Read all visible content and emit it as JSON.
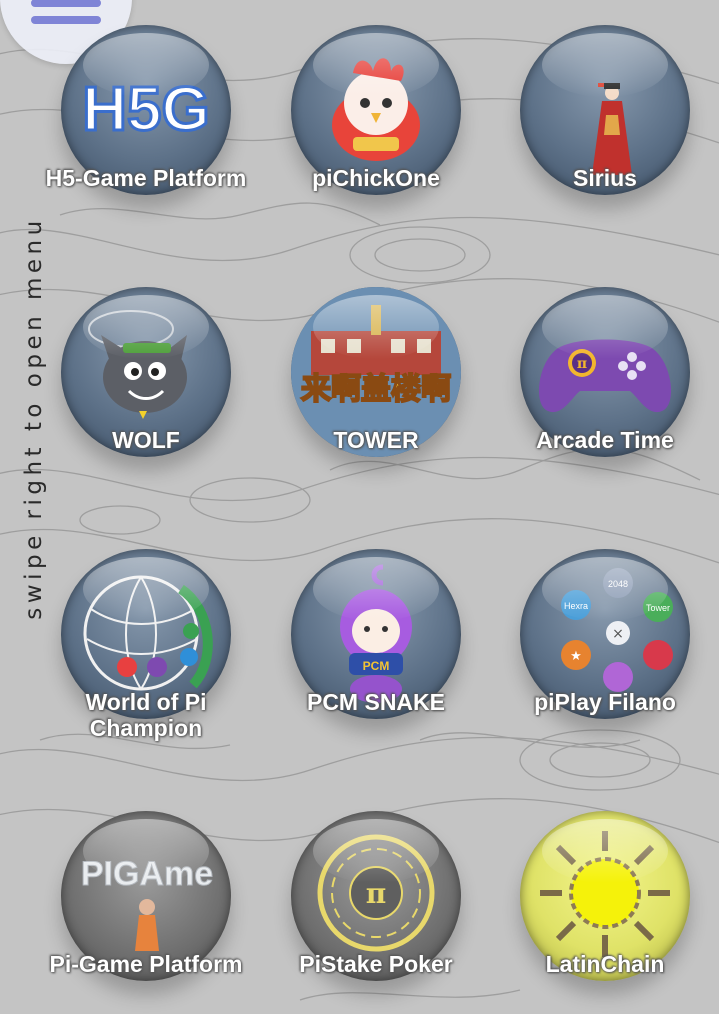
{
  "menu": {
    "icon": "hamburger-icon",
    "accent_color": "#7f84d6"
  },
  "swipe_hint": "swipe right to open menu",
  "games": [
    {
      "label": "H5-Game Platform",
      "icon": "h5g-logo-icon"
    },
    {
      "label": "piChickOne",
      "icon": "chicken-icon"
    },
    {
      "label": "Sirius",
      "icon": "geisha-icon"
    },
    {
      "label": "WOLF",
      "icon": "wolf-icon"
    },
    {
      "label": "TOWER",
      "icon": "tower-icon"
    },
    {
      "label": "Arcade Time",
      "icon": "gamepad-icon"
    },
    {
      "label": "World of Pi Champion",
      "icon": "globe-people-icon"
    },
    {
      "label": "PCM SNAKE",
      "icon": "purple-creature-icon"
    },
    {
      "label": "piPlay Filano",
      "icon": "app-circle-icon"
    },
    {
      "label": "Pi-Game Platform",
      "icon": "pigame-logo-icon"
    },
    {
      "label": "PiStake Poker",
      "icon": "pi-chip-icon"
    },
    {
      "label": "LatinChain",
      "icon": "chain-sun-icon"
    }
  ],
  "tower_chars": "来啊盖楼啊",
  "logos": {
    "h5g": "H5G",
    "pigame": "PIGAme",
    "pi": "π",
    "pcm": "PCM"
  },
  "filano_bubbles": [
    "2048",
    "Hexra",
    "Tower"
  ]
}
